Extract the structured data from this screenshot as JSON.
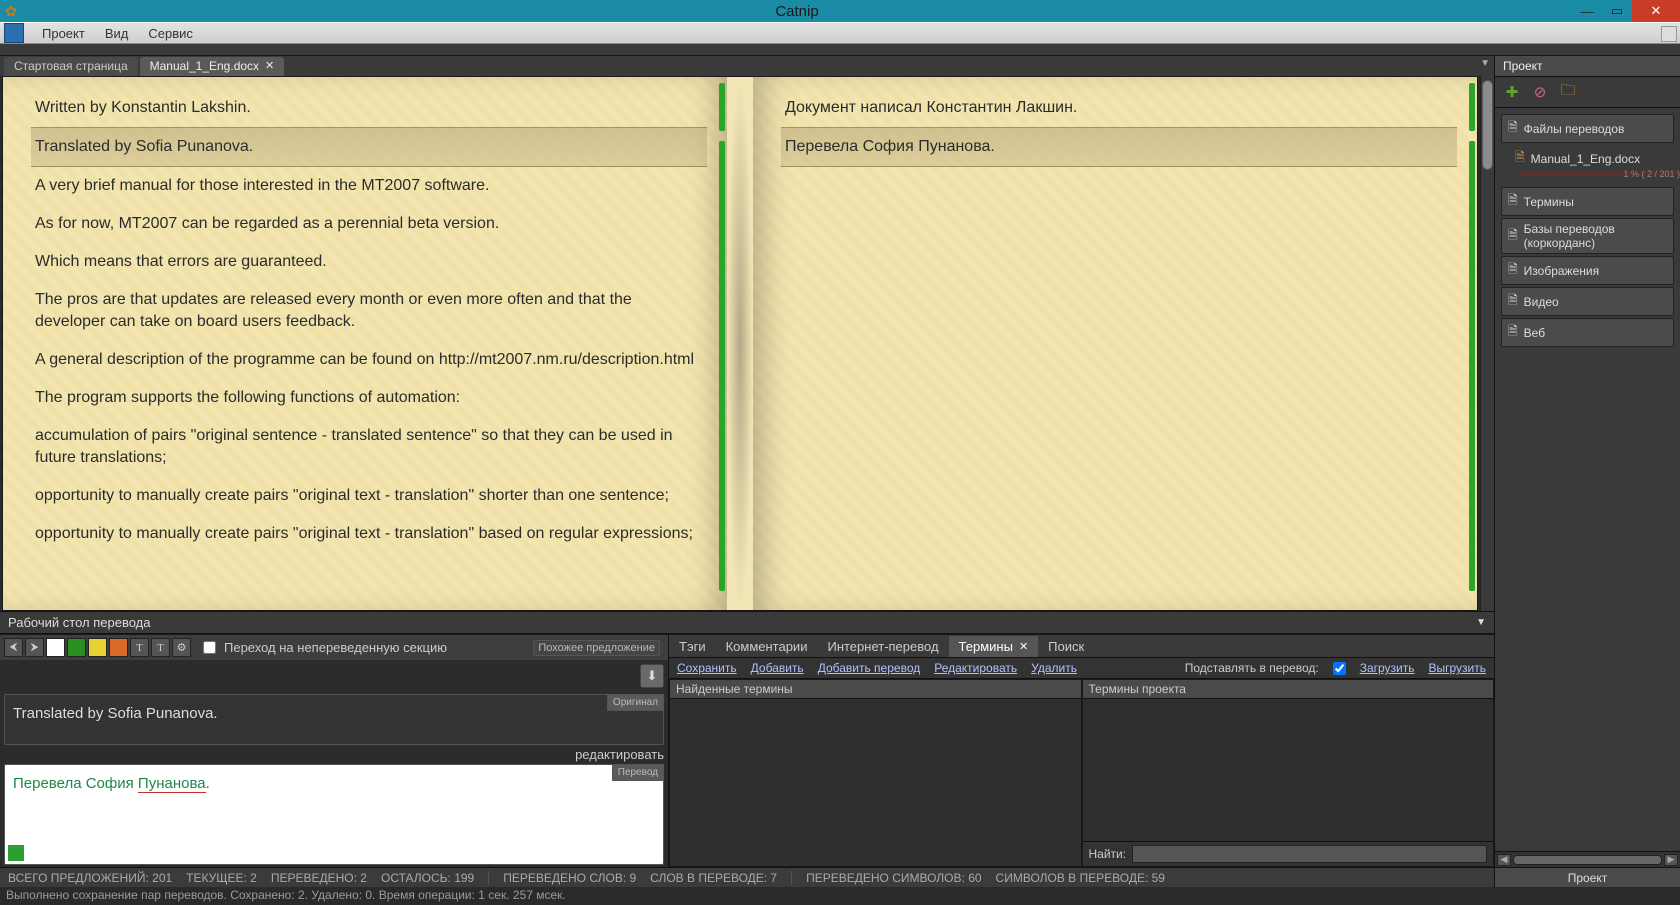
{
  "app": {
    "title": "Catnip"
  },
  "menu": {
    "project": "Проект",
    "view": "Вид",
    "service": "Сервис"
  },
  "doctabs": {
    "start": "Стартовая страница",
    "doc": "Manual_1_Eng.docx"
  },
  "segments_left": [
    "Written by Konstantin Lakshin.",
    "Translated by Sofia Punanova.",
    "A very brief manual for those interested in the MT2007 software.",
    "As for now, MT2007 can be regarded as a perennial beta version.",
    "Which means that errors are guaranteed.",
    "The pros are that updates are released every month or even more often and that the developer can take on board users feedback.",
    "A general description of the programme can be found on http://mt2007.nm.ru/description.html",
    "The program supports the following functions of automation:",
    "accumulation of pairs \"original sentence - translated sentence\" so that they can be used in future translations;",
    "opportunity to manually create pairs \"original text - translation\" shorter than one sentence;",
    "opportunity to manually create pairs \"original text - translation\" based on regular expressions;"
  ],
  "segments_right": [
    "Документ написал Константин Лакшин.",
    "Перевела София Пунанова."
  ],
  "translate": {
    "title": "Рабочий стол перевода",
    "goto_untranslated": "Переход на непереведенную секцию",
    "similar": "Похожее предложение",
    "original_label": "Оригинал",
    "edit_label": "редактировать",
    "translation_label": "Перевод",
    "original_text": "Translated by Sofia Punanova.",
    "translation_text_pre": "Перевела София ",
    "translation_text_under": "Пунанова",
    "translation_text_post": "."
  },
  "termtabs": {
    "tags": "Тэги",
    "comments": "Комментарии",
    "web": "Интернет-перевод",
    "terms": "Термины",
    "search": "Поиск"
  },
  "termlinks": {
    "save": "Сохранить",
    "add": "Добавить",
    "addtrans": "Добавить перевод",
    "edit": "Редактировать",
    "delete": "Удалить",
    "insert_label": "Подставлять в перевод:",
    "load": "Загрузить",
    "unload": "Выгрузить"
  },
  "termcols": {
    "found": "Найденные термины",
    "project": "Термины проекта"
  },
  "termfind": {
    "label": "Найти:"
  },
  "status": {
    "total": "ВСЕГО ПРЕДЛОЖЕНИЙ: 201",
    "current": "ТЕКУЩЕЕ: 2",
    "translated": "ПЕРЕВЕДЕНО: 2",
    "remaining": "ОСТАЛОСЬ: 199",
    "words_translated": "ПЕРЕВЕДЕНО СЛОВ: 9",
    "words_in": "СЛОВ В ПЕРЕВОДЕ: 7",
    "chars_translated": "ПЕРЕВЕДЕНО СИМВОЛОВ: 60",
    "chars_in": "СИМВОЛОВ В ПЕРЕВОДЕ: 59"
  },
  "statusline": "Выполнено сохранение пар переводов. Сохранено: 2. Удалено: 0. Время операции: 1 сек. 257 мсек.",
  "project": {
    "title": "Проект",
    "files": "Файлы переводов",
    "file1": "Manual_1_Eng.docx",
    "file1_progress": "1 %   ( 2 / 201 )",
    "terms": "Термины",
    "tm": "Базы переводов (коркорданс)",
    "images": "Изображения",
    "video": "Видео",
    "web": "Веб",
    "footer": "Проект"
  }
}
